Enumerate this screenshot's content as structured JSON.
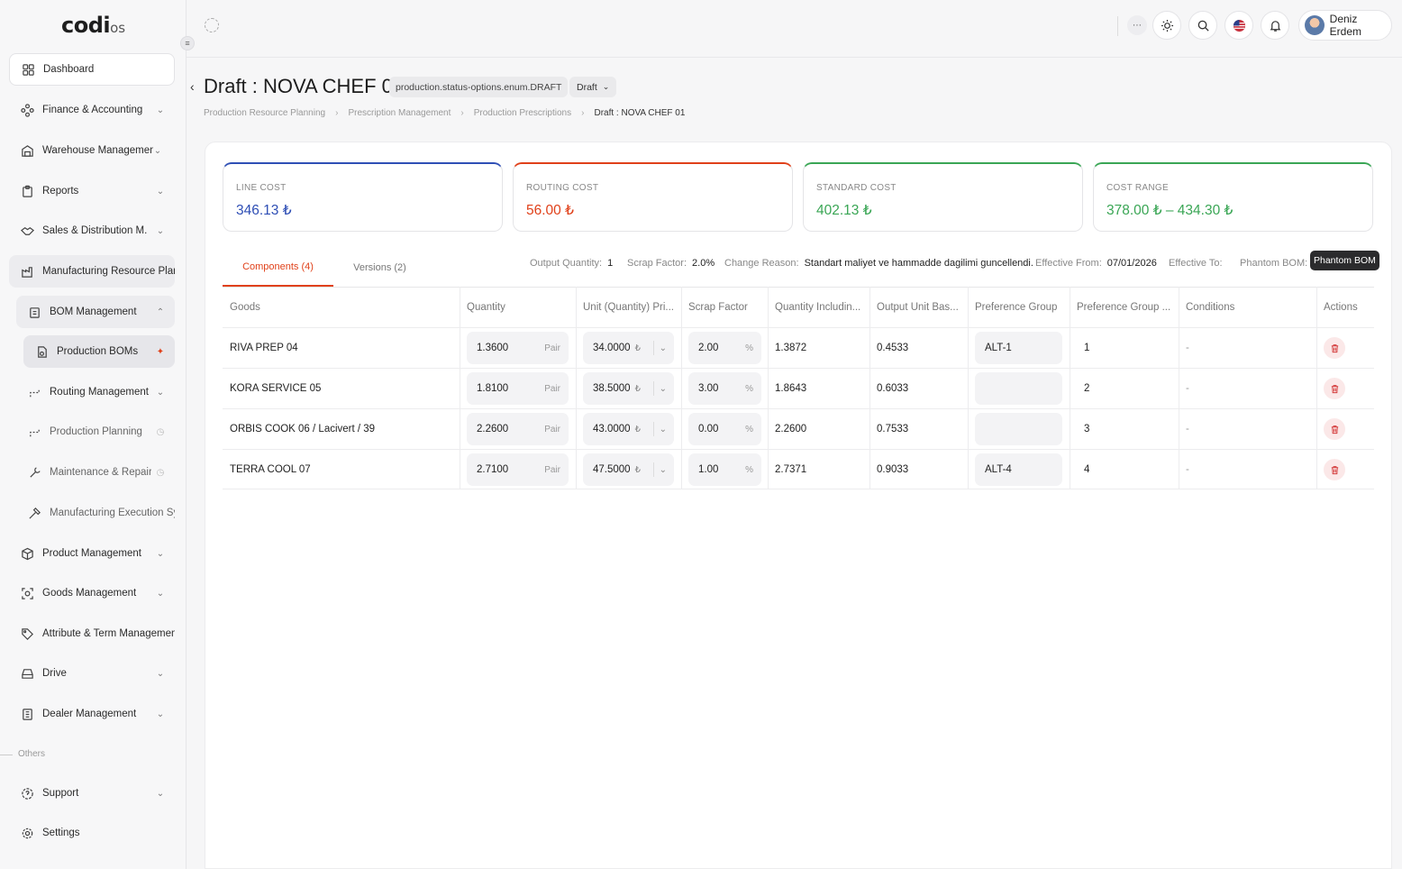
{
  "brand": {
    "logo_main": "codi",
    "logo_suffix": "os"
  },
  "sidebar": {
    "items": [
      {
        "label": "Dashboard"
      },
      {
        "label": "Finance & Accounting"
      },
      {
        "label": "Warehouse Management"
      },
      {
        "label": "Reports"
      },
      {
        "label": "Sales & Distribution M."
      },
      {
        "label": "Manufacturing Resource Planni"
      },
      {
        "label": "BOM Management"
      },
      {
        "label": "Production BOMs"
      },
      {
        "label": "Routing Management"
      },
      {
        "label": "Production Planning"
      },
      {
        "label": "Maintenance & Repair"
      },
      {
        "label": "Manufacturing Execution Syst"
      },
      {
        "label": "Product Management"
      },
      {
        "label": "Goods Management"
      },
      {
        "label": "Attribute & Term Management"
      },
      {
        "label": "Drive"
      },
      {
        "label": "Dealer Management"
      }
    ],
    "section_others": "Others",
    "bottom_items": [
      {
        "label": "Support"
      },
      {
        "label": "Settings"
      }
    ]
  },
  "topbar": {
    "user_name": "Deniz Erdem"
  },
  "header": {
    "title": "Draft : NOVA CHEF 01",
    "status_chip": "production.status-options.enum.DRAFT",
    "status_select": "Draft",
    "breadcrumbs": [
      "Production Resource Planning",
      "Prescription Management",
      "Production Prescriptions",
      "Draft : NOVA CHEF 01"
    ]
  },
  "kpis": [
    {
      "label": "LINE COST",
      "value": "346.13 ₺",
      "color": "#2f4fb5"
    },
    {
      "label": "ROUTING COST",
      "value": "56.00 ₺",
      "color": "#e0411a"
    },
    {
      "label": "STANDARD COST",
      "value": "402.13 ₺",
      "color": "#3aa655"
    },
    {
      "label": "COST RANGE",
      "value": "378.00 ₺ – 434.30 ₺",
      "color": "#3aa655"
    }
  ],
  "tabs": [
    {
      "label": "Components (4)"
    },
    {
      "label": "Versions (2)"
    }
  ],
  "meta": {
    "output_quantity_label": "Output Quantity:",
    "output_quantity": "1",
    "scrap_factor_label": "Scrap Factor:",
    "scrap_factor": "2.0%",
    "change_reason_label": "Change Reason:",
    "change_reason": "Standart maliyet ve hammadde dagilimi guncellendi.",
    "effective_from_label": "Effective From:",
    "effective_from": "07/01/2026",
    "effective_to_label": "Effective To:",
    "phantom_label": "Phantom BOM:",
    "phantom_value": "Phantom BOM"
  },
  "table": {
    "columns": [
      "Goods",
      "Quantity",
      "Unit (Quantity) Pri...",
      "Scrap Factor",
      "Quantity Includin...",
      "Output Unit Bas...",
      "Preference Group",
      "Preference Group ...",
      "Conditions",
      "Actions"
    ],
    "rows": [
      {
        "goods": "RIVA PREP 04",
        "quantity": "1.3600",
        "unit": "Pair",
        "price": "34.0000",
        "currency": "₺",
        "scrap": "2.00",
        "pct": "%",
        "qty_incl": "1.3872",
        "out_unit": "0.4533",
        "pref_group": "ALT-1",
        "pref_order": "1",
        "conditions": "-"
      },
      {
        "goods": "KORA SERVICE 05",
        "quantity": "1.8100",
        "unit": "Pair",
        "price": "38.5000",
        "currency": "₺",
        "scrap": "3.00",
        "pct": "%",
        "qty_incl": "1.8643",
        "out_unit": "0.6033",
        "pref_group": "",
        "pref_order": "2",
        "conditions": "-"
      },
      {
        "goods": "ORBIS COOK 06 / Lacivert / 39",
        "quantity": "2.2600",
        "unit": "Pair",
        "price": "43.0000",
        "currency": "₺",
        "scrap": "0.00",
        "pct": "%",
        "qty_incl": "2.2600",
        "out_unit": "0.7533",
        "pref_group": "",
        "pref_order": "3",
        "conditions": "-"
      },
      {
        "goods": "TERRA COOL 07",
        "quantity": "2.7100",
        "unit": "Pair",
        "price": "47.5000",
        "currency": "₺",
        "scrap": "1.00",
        "pct": "%",
        "qty_incl": "2.7371",
        "out_unit": "0.9033",
        "pref_group": "ALT-4",
        "pref_order": "4",
        "conditions": "-"
      }
    ]
  }
}
